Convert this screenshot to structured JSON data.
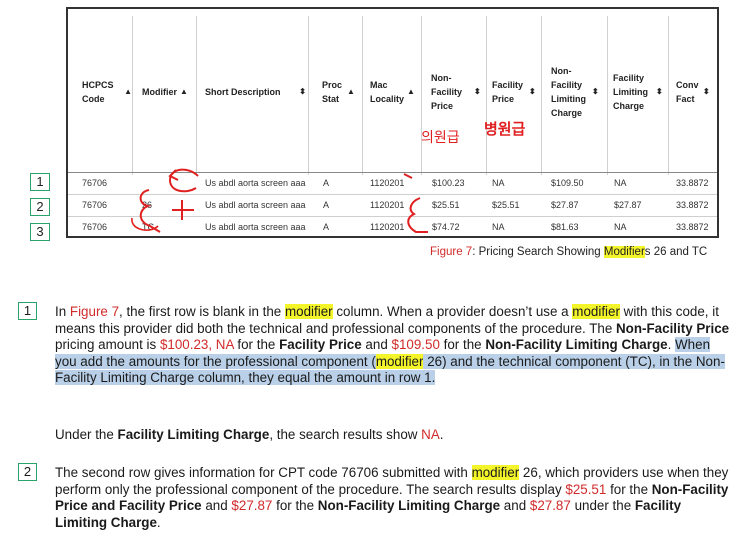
{
  "table": {
    "headers": [
      {
        "label": "HCPCS Code",
        "sort": "▲"
      },
      {
        "label": "Modifier",
        "sort": "▲"
      },
      {
        "label": "Short Description",
        "sort": "⬍"
      },
      {
        "label": "Proc Stat",
        "sort": "▲"
      },
      {
        "label": "Mac Locality",
        "sort": "▲"
      },
      {
        "label": "Non-Facility Price",
        "sort": "⬍"
      },
      {
        "label": "Facility Price",
        "sort": "⬍"
      },
      {
        "label": "Non-Facility Limiting Charge",
        "sort": "⬍"
      },
      {
        "label": "Facility Limiting Charge",
        "sort": "⬍"
      },
      {
        "label": "Conv Fact",
        "sort": "⬍"
      }
    ],
    "rows": [
      [
        "76706",
        "",
        "Us abdl aorta screen aaa",
        "A",
        "1120201",
        "$100.23",
        "NA",
        "$109.50",
        "NA",
        "33.8872"
      ],
      [
        "76706",
        "26",
        "Us abdl aorta screen aaa",
        "A",
        "1120201",
        "$25.51",
        "$25.51",
        "$27.87",
        "$27.87",
        "33.8872"
      ],
      [
        "76706",
        "TC",
        "Us abdl aorta screen aaa",
        "A",
        "1120201",
        "$74.72",
        "NA",
        "$81.63",
        "NA",
        "33.8872"
      ]
    ],
    "row_numbers": [
      "1",
      "2",
      "3"
    ]
  },
  "annotations": {
    "korean_left": "의원급",
    "korean_right": "병원급"
  },
  "caption": {
    "fig": "Figure 7",
    "colon": ": Pricing Search Showing ",
    "hl": "Modifier",
    "rest": "s 26 and TC"
  },
  "paragraphs": {
    "p1_num": "1",
    "p1": {
      "a": "In ",
      "fig": "Figure 7",
      "b": ", the first row is blank in the ",
      "mod1": "modifier",
      "c": " column. When a provider doesn’t use a ",
      "mod2": "modifier",
      "d": " with this code, it means this provider did both the technical and professional components of the procedure. The ",
      "nfp": "Non-Facility Price",
      "e": " pricing amount is ",
      "v1": "$100.23, NA",
      "f": " for the ",
      "fp": "Facility Price",
      "g": " and ",
      "v2": "$109.50",
      "h": " for the ",
      "nflc": "Non-Facility Limiting Charge",
      "i": ". ",
      "sel1": "When you add the amounts for the professional component (",
      "mod3": "modifier",
      "sel2": " 26) and the technical component (TC), in the Non-Facility Limiting Charge column, they equal the amount in row 1."
    },
    "p1b": {
      "a": "Under the ",
      "flc": "Facility Limiting Charge",
      "b": ", the search results show ",
      "na": "NA",
      "c": "."
    },
    "p2_num": "2",
    "p2": {
      "a": "The second row gives information for CPT code 76706 submitted with ",
      "mod": "modifier",
      "b": " 26, which providers use when they perform only the professional component of the procedure. The search results display ",
      "v1": "$25.51",
      "c": " for the ",
      "nfpfp": "Non-Facility Price and Facility Price",
      "d": " and ",
      "v2": "$27.87",
      "e": " for the ",
      "nflc": "Non-Facility Limiting Charge",
      "f": " and ",
      "v3": "$27.87",
      "g": " under the ",
      "flc": "Facility Limiting Charge",
      "h": "."
    }
  }
}
